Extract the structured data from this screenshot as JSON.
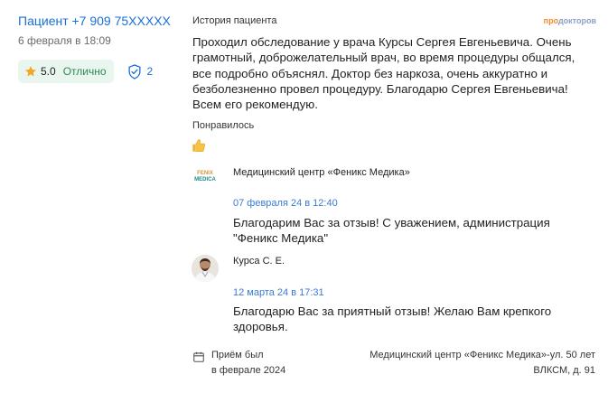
{
  "reviewer": {
    "name": "Пациент +7 909 75XXXXX",
    "date": "6 февраля в 18:09",
    "rating_value": "5.0",
    "rating_text": "Отлично",
    "verified_count": "2"
  },
  "review": {
    "section_title": "История пациента",
    "brand": {
      "part1": "про",
      "part2": "докторов"
    },
    "text": "Проходил обследование у врача Курсы Сергея Евгеньевича. Очень грамотный, доброжелательный врач, во время процедуры общался, все подробно объяснял. Доктор без наркоза, очень аккуратно и безболезненно провел процедуру. Благодарю Сергея Евгеньевича! Всем его рекомендую.",
    "liked_title": "Понравилось"
  },
  "replies": [
    {
      "author": "Медицинский центр «Феникс Медика»",
      "logo_text": [
        "FENIX",
        "MEDICA"
      ],
      "date": "07 февраля 24 в 12:40",
      "text": "Благодарим Вас за отзыв! С уважением, администрация \"Феникс Медика\""
    },
    {
      "author": "Курса С. Е.",
      "date": "12 марта 24 в 17:31",
      "text": "Благодарю Вас за приятный отзыв! Желаю Вам крепкого здоровья."
    }
  ],
  "visit": {
    "line1": "Приём был",
    "line2": "в феврале 2024",
    "clinic_line1": "Медицинский центр «Феникс Медика»-ул. 50 лет",
    "clinic_line2": "ВЛКСМ, д. 91"
  },
  "colors": {
    "link": "#1a6fd6",
    "rating_bg": "#e8f6ef",
    "rating_text": "#2e8a4f",
    "star": "#f5a623",
    "reply_date": "#3a7bd5"
  },
  "icons": [
    "star-icon",
    "shield-check-icon",
    "thumbs-up-icon",
    "calendar-icon"
  ]
}
